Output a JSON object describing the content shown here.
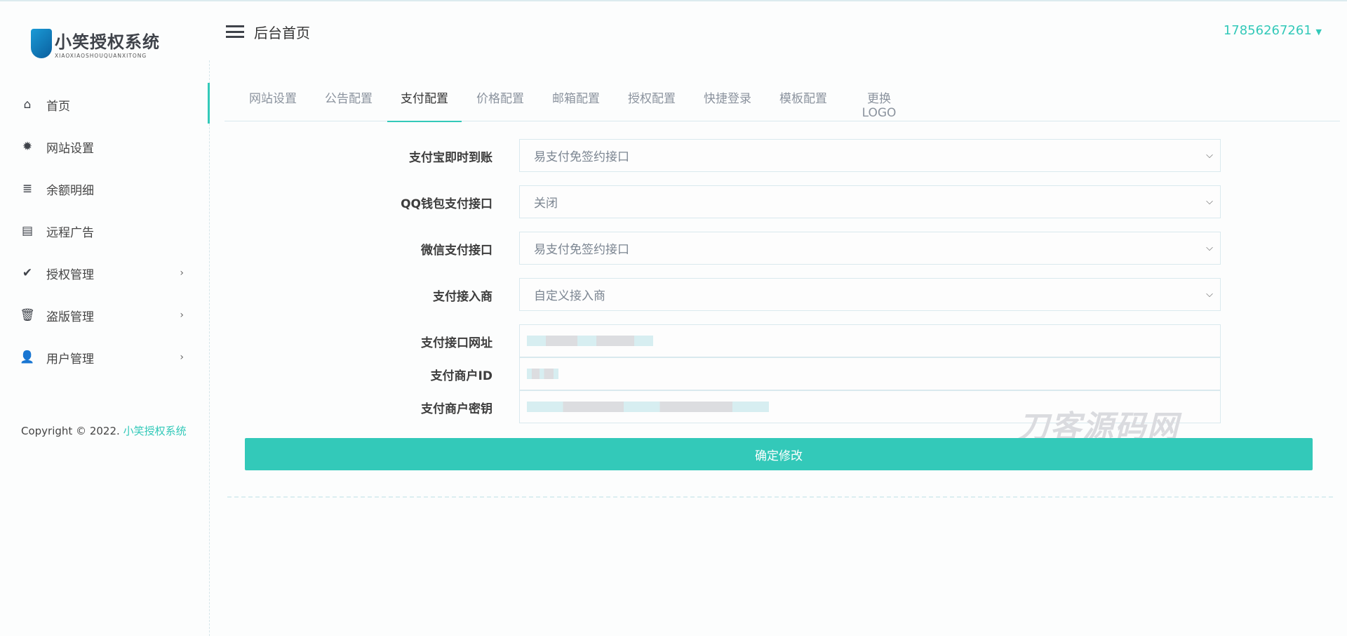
{
  "logo": {
    "title": "小笑授权系统",
    "subtitle": "XIAOXIAOSHOUQUANXITONG",
    "mark": "G"
  },
  "header": {
    "title": "后台首页",
    "user": "17856267261"
  },
  "sidebar": {
    "items": [
      {
        "label": "首页",
        "icon": "⌂",
        "has_sub": false
      },
      {
        "label": "网站设置",
        "icon": "✹",
        "has_sub": false
      },
      {
        "label": "余额明细",
        "icon": "≣",
        "has_sub": false
      },
      {
        "label": "远程广告",
        "icon": "▤",
        "has_sub": false
      },
      {
        "label": "授权管理",
        "icon": "✔",
        "has_sub": true
      },
      {
        "label": "盗版管理",
        "icon": "🗑",
        "has_sub": true
      },
      {
        "label": "用户管理",
        "icon": "👤",
        "has_sub": true
      }
    ],
    "copyright": "Copyright © 2022.",
    "copyright_link": "小笑授权系统"
  },
  "tabs": [
    "网站设置",
    "公告配置",
    "支付配置",
    "价格配置",
    "邮箱配置",
    "授权配置",
    "快捷登录",
    "模板配置",
    "更换LOGO"
  ],
  "active_tab": "支付配置",
  "form": {
    "alipay": {
      "label": "支付宝即时到账",
      "value": "易支付免签约接口"
    },
    "qqpay": {
      "label": "QQ钱包支付接口",
      "value": "关闭"
    },
    "wxpay": {
      "label": "微信支付接口",
      "value": "易支付免签约接口"
    },
    "provider": {
      "label": "支付接入商",
      "value": "自定义接入商"
    },
    "api_url": {
      "label": "支付接口网址"
    },
    "merchant_id": {
      "label": "支付商户ID"
    },
    "merchant_key": {
      "label": "支付商户密钥"
    },
    "submit": "确定修改"
  },
  "watermark": "刀客源码网",
  "colors": {
    "accent": "#33c9b9"
  }
}
